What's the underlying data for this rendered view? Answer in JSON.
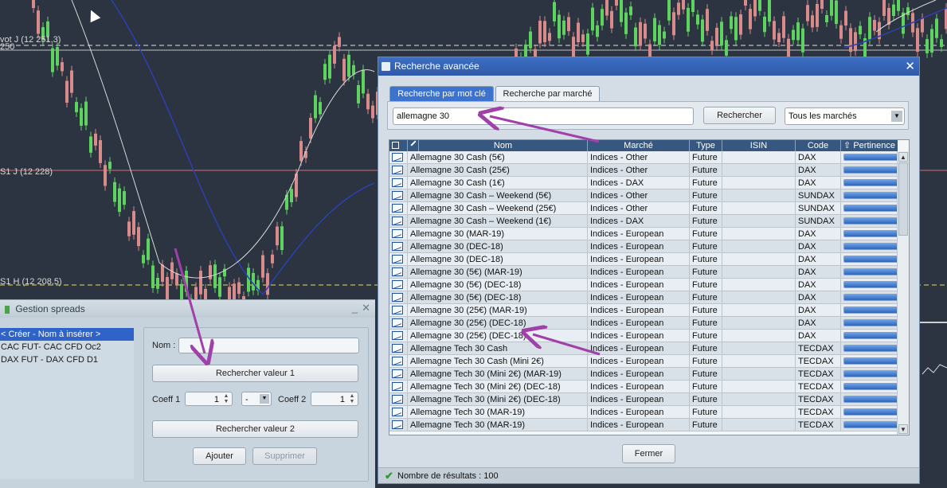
{
  "chart": {
    "levels": [
      {
        "label": "vot J (12 251,3)"
      },
      {
        "label": "250"
      },
      {
        "label": "S1 J (12 228)"
      },
      {
        "label": "S1 H (12 208,5)"
      }
    ],
    "colors": {
      "up": "#5fd35f",
      "down": "#d98a8a",
      "ma_blue": "#2e3fb0",
      "ma_light": "#d9d9d9",
      "background": "#2b3440"
    }
  },
  "spreads_window": {
    "title": "Gestion spreads",
    "minimize_glyph": "_",
    "close_glyph": "✕",
    "items": [
      {
        "label": "< Créer - Nom à insérer >",
        "selected": true
      },
      {
        "label": "CAC FUT- CAC CFD Oc2",
        "selected": false
      },
      {
        "label": "DAX FUT - DAX CFD D1",
        "selected": false
      }
    ],
    "form": {
      "name_label": "Nom :",
      "name_value": "",
      "search1_label": "Rechercher valeur 1",
      "coeff1_label": "Coeff 1",
      "coeff1_value": "1",
      "operator_value": "-",
      "coeff2_label": "Coeff 2",
      "coeff2_value": "1",
      "search2_label": "Rechercher valeur 2",
      "add_label": "Ajouter",
      "delete_label": "Supprimer"
    }
  },
  "search_window": {
    "title": "Recherche avancée",
    "close_glyph": "✕",
    "tabs": [
      {
        "label": "Recherche par mot clé",
        "active": true
      },
      {
        "label": "Recherche par marché",
        "active": false
      }
    ],
    "query": "allemagne 30",
    "search_button": "Rechercher",
    "market_select": "Tous les marchés",
    "columns": [
      "Nom",
      "Marché",
      "Type",
      "ISIN",
      "Code",
      "Pertinence"
    ],
    "rows": [
      {
        "name": "Allemagne 30 Cash (5€)",
        "market": "Indices - Other",
        "type": "Future",
        "isin": "",
        "code": "DAX",
        "relevance": 1.0
      },
      {
        "name": "Allemagne 30 Cash (25€)",
        "market": "Indices - Other",
        "type": "Future",
        "isin": "",
        "code": "DAX",
        "relevance": 1.0
      },
      {
        "name": "Allemagne 30 Cash (1€)",
        "market": "Indices - DAX",
        "type": "Future",
        "isin": "",
        "code": "DAX",
        "relevance": 1.0
      },
      {
        "name": "Allemagne 30 Cash – Weekend (5€)",
        "market": "Indices - Other",
        "type": "Future",
        "isin": "",
        "code": "SUNDAX",
        "relevance": 1.0
      },
      {
        "name": "Allemagne 30 Cash – Weekend (25€)",
        "market": "Indices - Other",
        "type": "Future",
        "isin": "",
        "code": "SUNDAX",
        "relevance": 1.0
      },
      {
        "name": "Allemagne 30 Cash – Weekend (1€)",
        "market": "Indices - DAX",
        "type": "Future",
        "isin": "",
        "code": "SUNDAX",
        "relevance": 1.0
      },
      {
        "name": "Allemagne 30 (MAR-19)",
        "market": "Indices - European",
        "type": "Future",
        "isin": "",
        "code": "DAX",
        "relevance": 1.0
      },
      {
        "name": "Allemagne 30 (DEC-18)",
        "market": "Indices - European",
        "type": "Future",
        "isin": "",
        "code": "DAX",
        "relevance": 1.0
      },
      {
        "name": "Allemagne 30 (DEC-18)",
        "market": "Indices - European",
        "type": "Future",
        "isin": "",
        "code": "DAX",
        "relevance": 1.0
      },
      {
        "name": "Allemagne 30 (5€) (MAR-19)",
        "market": "Indices - European",
        "type": "Future",
        "isin": "",
        "code": "DAX",
        "relevance": 1.0
      },
      {
        "name": "Allemagne 30 (5€) (DEC-18)",
        "market": "Indices - European",
        "type": "Future",
        "isin": "",
        "code": "DAX",
        "relevance": 1.0
      },
      {
        "name": "Allemagne 30 (5€) (DEC-18)",
        "market": "Indices - European",
        "type": "Future",
        "isin": "",
        "code": "DAX",
        "relevance": 1.0
      },
      {
        "name": "Allemagne 30 (25€) (MAR-19)",
        "market": "Indices - European",
        "type": "Future",
        "isin": "",
        "code": "DAX",
        "relevance": 1.0
      },
      {
        "name": "Allemagne 30 (25€) (DEC-18)",
        "market": "Indices - European",
        "type": "Future",
        "isin": "",
        "code": "DAX",
        "relevance": 1.0
      },
      {
        "name": "Allemagne 30 (25€) (DEC-18)",
        "market": "Indices - European",
        "type": "Future",
        "isin": "",
        "code": "DAX",
        "relevance": 1.0
      },
      {
        "name": "Allemagne Tech 30 Cash",
        "market": "Indices - European",
        "type": "Future",
        "isin": "",
        "code": "TECDAX",
        "relevance": 0.93
      },
      {
        "name": "Allemagne Tech 30 Cash (Mini 2€)",
        "market": "Indices - European",
        "type": "Future",
        "isin": "",
        "code": "TECDAX",
        "relevance": 0.93
      },
      {
        "name": "Allemagne Tech 30 (Mini 2€) (MAR-19)",
        "market": "Indices - European",
        "type": "Future",
        "isin": "",
        "code": "TECDAX",
        "relevance": 0.93
      },
      {
        "name": "Allemagne Tech 30 (Mini 2€) (DEC-18)",
        "market": "Indices - European",
        "type": "Future",
        "isin": "",
        "code": "TECDAX",
        "relevance": 0.93
      },
      {
        "name": "Allemagne Tech 30 (Mini 2€) (DEC-18)",
        "market": "Indices - European",
        "type": "Future",
        "isin": "",
        "code": "TECDAX",
        "relevance": 0.93
      },
      {
        "name": "Allemagne Tech 30 (MAR-19)",
        "market": "Indices - European",
        "type": "Future",
        "isin": "",
        "code": "TECDAX",
        "relevance": 0.93
      },
      {
        "name": "Allemagne Tech 30 (MAR-19)",
        "market": "Indices - European",
        "type": "Future",
        "isin": "",
        "code": "TECDAX",
        "relevance": 0.93
      }
    ],
    "close_button": "Fermer",
    "status": "Nombre de résultats : 100",
    "accent": "#3b73cf",
    "header_color": "#36577f"
  },
  "annotation_color": "#a040a8"
}
